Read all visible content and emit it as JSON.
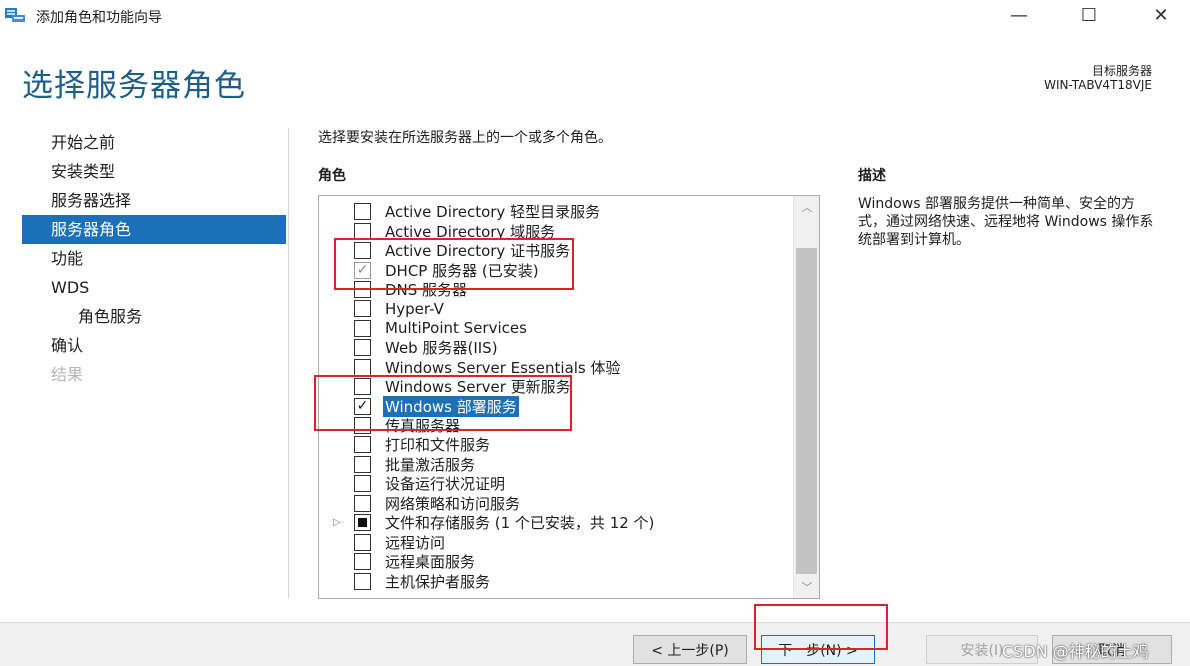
{
  "window": {
    "title": "添加角色和功能向导",
    "icon": "server-manager-icon",
    "controls": {
      "minimize": "—",
      "maximize": "☐",
      "close": "✕"
    }
  },
  "header": {
    "title": "选择服务器角色",
    "target_label": "目标服务器",
    "target_value": "WIN-TABV4T18VJE"
  },
  "nav": {
    "items": [
      {
        "label": "开始之前",
        "state": "normal"
      },
      {
        "label": "安装类型",
        "state": "normal"
      },
      {
        "label": "服务器选择",
        "state": "normal"
      },
      {
        "label": "服务器角色",
        "state": "active"
      },
      {
        "label": "功能",
        "state": "normal"
      },
      {
        "label": "WDS",
        "state": "normal"
      },
      {
        "label": "角色服务",
        "state": "sub"
      },
      {
        "label": "确认",
        "state": "normal"
      },
      {
        "label": "结果",
        "state": "disabled"
      }
    ]
  },
  "main": {
    "instruction": "选择要安装在所选服务器上的一个或多个角色。",
    "roles_heading": "角色",
    "roles": [
      {
        "label": "Active Directory 轻型目录服务",
        "check": "none"
      },
      {
        "label": "Active Directory 域服务",
        "check": "none"
      },
      {
        "label": "Active Directory 证书服务",
        "check": "none"
      },
      {
        "label": "DHCP 服务器 (已安装)",
        "check": "installed"
      },
      {
        "label": "DNS 服务器",
        "check": "none"
      },
      {
        "label": "Hyper-V",
        "check": "none"
      },
      {
        "label": "MultiPoint Services",
        "check": "none"
      },
      {
        "label": "Web 服务器(IIS)",
        "check": "none"
      },
      {
        "label": "Windows Server Essentials 体验",
        "check": "none"
      },
      {
        "label": "Windows Server 更新服务",
        "check": "none"
      },
      {
        "label": "Windows 部署服务",
        "check": "checked",
        "selected": true
      },
      {
        "label": "传真服务器",
        "check": "none"
      },
      {
        "label": "打印和文件服务",
        "check": "none"
      },
      {
        "label": "批量激活服务",
        "check": "none"
      },
      {
        "label": "设备运行状况证明",
        "check": "none"
      },
      {
        "label": "网络策略和访问服务",
        "check": "none"
      },
      {
        "label": "文件和存储服务 (1 个已安装，共 12 个)",
        "check": "partial",
        "expandable": true
      },
      {
        "label": "远程访问",
        "check": "none"
      },
      {
        "label": "远程桌面服务",
        "check": "none"
      },
      {
        "label": "主机保护者服务",
        "check": "none"
      }
    ],
    "description_heading": "描述",
    "description": "Windows 部署服务提供一种简单、安全的方式，通过网络快速、远程地将 Windows 操作系统部署到计算机。"
  },
  "footer": {
    "prev_label": "< 上一步(P)",
    "next_label": "下一步(N) >",
    "install_label": "安装(I)",
    "cancel_label": "取消"
  },
  "watermark": "CSDN @神秘的土鸡",
  "colors": {
    "accent": "#1c70b8",
    "title": "#1d5f8a",
    "annotation": "#e0202a"
  }
}
